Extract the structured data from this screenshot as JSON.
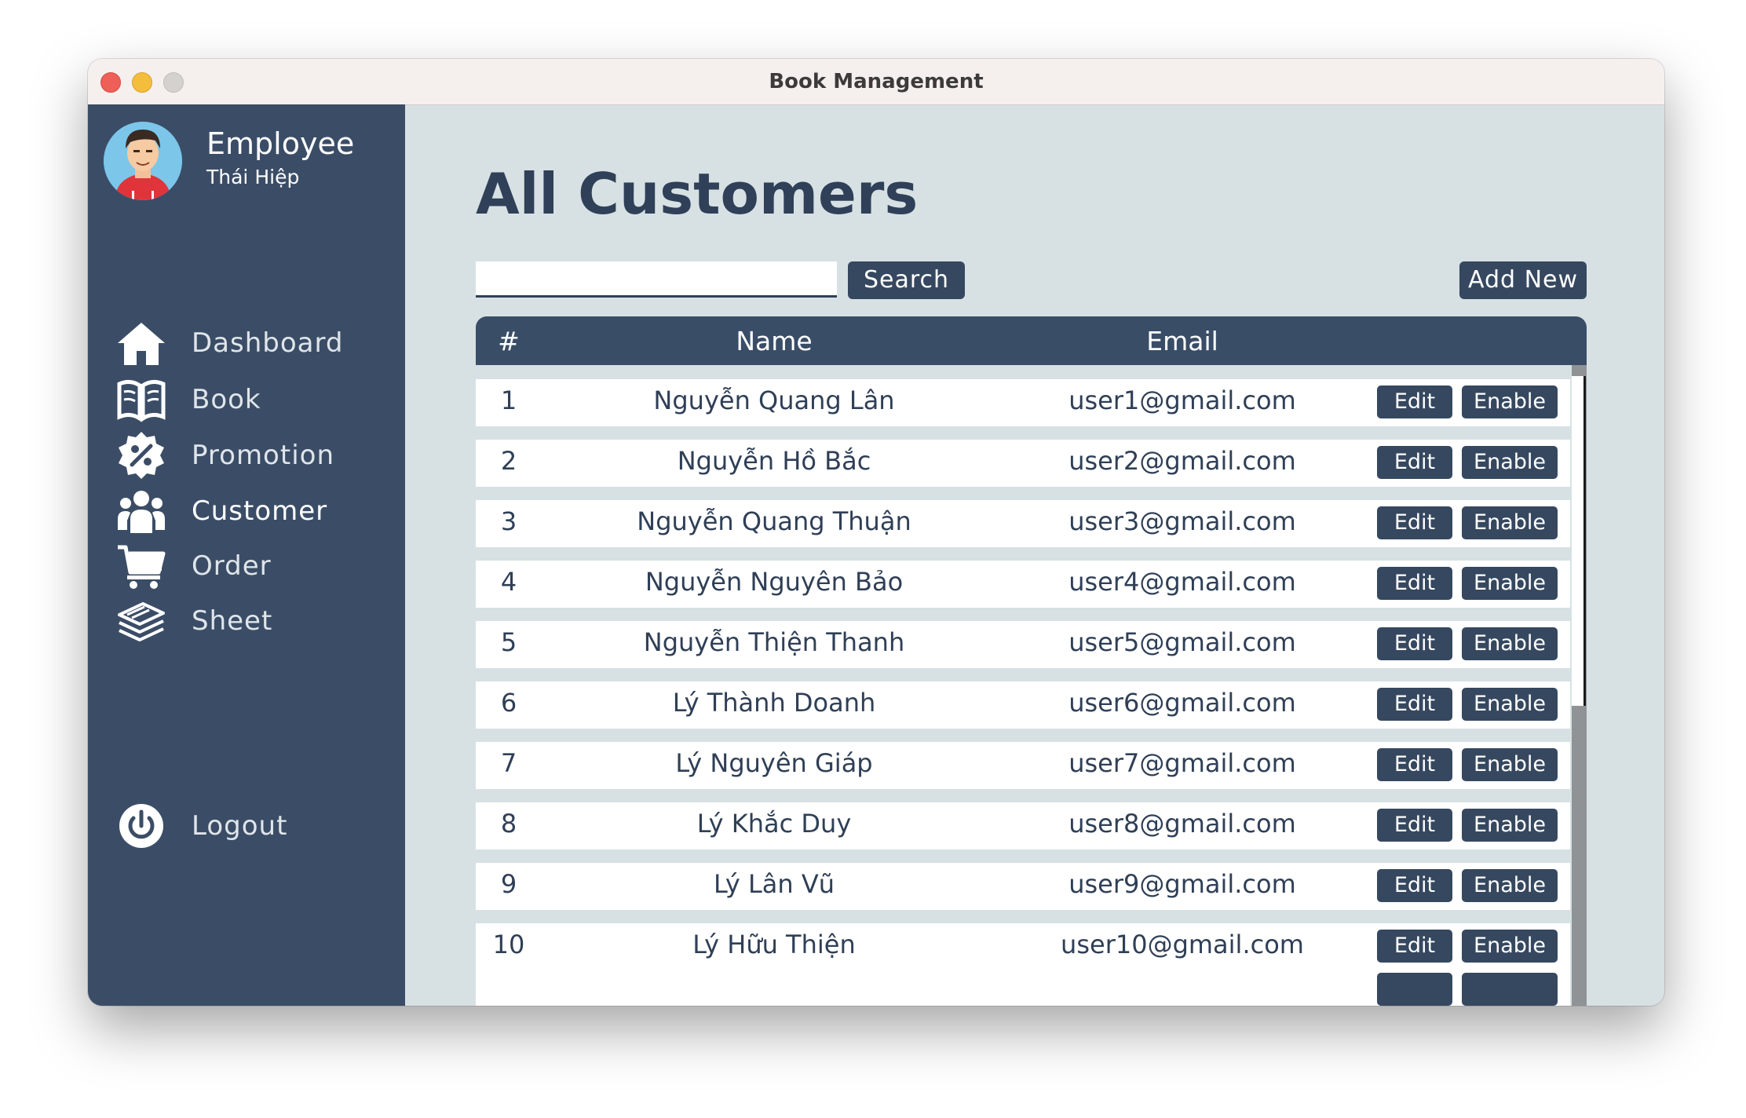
{
  "window": {
    "title": "Book Management"
  },
  "profile": {
    "role": "Employee",
    "name": "Thái Hiệp"
  },
  "sidebar": {
    "items": [
      {
        "label": "Dashboard",
        "icon": "home-icon"
      },
      {
        "label": "Book",
        "icon": "open-book-icon"
      },
      {
        "label": "Promotion",
        "icon": "percent-badge-icon"
      },
      {
        "label": "Customer",
        "icon": "users-icon",
        "active": true
      },
      {
        "label": "Order",
        "icon": "cart-icon"
      },
      {
        "label": "Sheet",
        "icon": "layers-icon"
      }
    ],
    "logout": {
      "label": "Logout",
      "icon": "power-icon"
    }
  },
  "main": {
    "title": "All Customers",
    "search": {
      "value": "",
      "button": "Search"
    },
    "add_button": "Add New",
    "table": {
      "columns": [
        "#",
        "Name",
        "Email"
      ],
      "rows": [
        {
          "num": "1",
          "name": "Nguyễn Quang Lân",
          "email": "user1@gmail.com"
        },
        {
          "num": "2",
          "name": "Nguyễn Hồ Bắc",
          "email": "user2@gmail.com"
        },
        {
          "num": "3",
          "name": "Nguyễn Quang Thuận",
          "email": "user3@gmail.com"
        },
        {
          "num": "4",
          "name": "Nguyễn Nguyên Bảo",
          "email": "user4@gmail.com"
        },
        {
          "num": "5",
          "name": "Nguyễn Thiện Thanh",
          "email": "user5@gmail.com"
        },
        {
          "num": "6",
          "name": "Lý Thành Doanh",
          "email": "user6@gmail.com"
        },
        {
          "num": "7",
          "name": "Lý Nguyên Giáp",
          "email": "user7@gmail.com"
        },
        {
          "num": "8",
          "name": "Lý Khắc Duy",
          "email": "user8@gmail.com"
        },
        {
          "num": "9",
          "name": "Lý Lân Vũ",
          "email": "user9@gmail.com"
        },
        {
          "num": "10",
          "name": "Lý Hữu Thiện",
          "email": "user10@gmail.com"
        }
      ],
      "row_actions": {
        "edit": "Edit",
        "enable": "Enable"
      }
    }
  },
  "colors": {
    "sidebar_bg": "#3b4d66",
    "main_bg": "#d7e1e4",
    "button_bg": "#36485f",
    "title_color": "#2f4058"
  }
}
